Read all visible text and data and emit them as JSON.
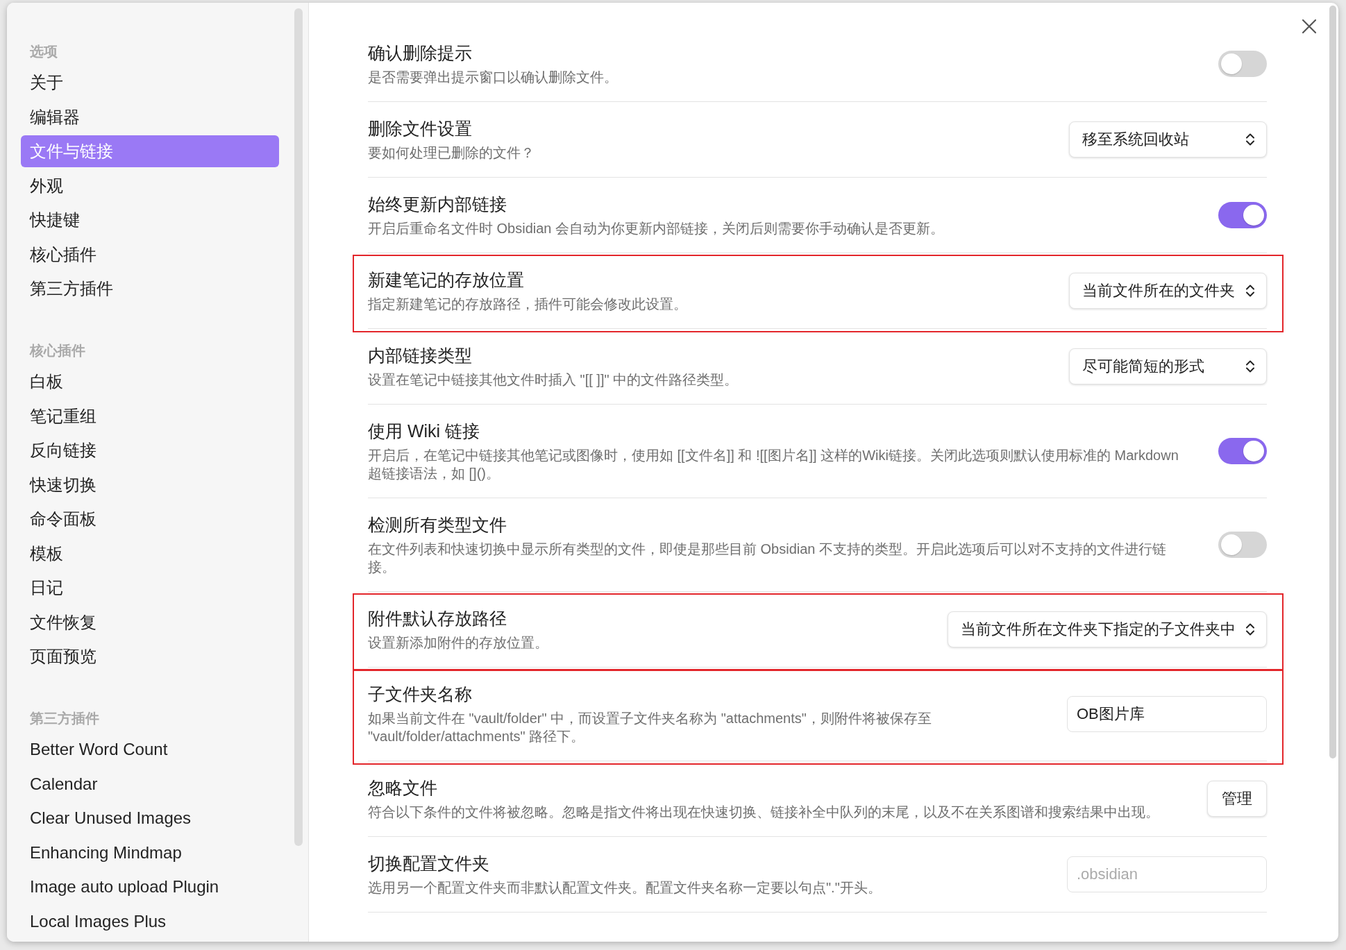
{
  "sidebar": {
    "groups": [
      {
        "heading": "选项",
        "items": [
          {
            "label": "关于",
            "selected": false
          },
          {
            "label": "编辑器",
            "selected": false
          },
          {
            "label": "文件与链接",
            "selected": true
          },
          {
            "label": "外观",
            "selected": false
          },
          {
            "label": "快捷键",
            "selected": false
          },
          {
            "label": "核心插件",
            "selected": false
          },
          {
            "label": "第三方插件",
            "selected": false
          }
        ]
      },
      {
        "heading": "核心插件",
        "items": [
          {
            "label": "白板",
            "selected": false
          },
          {
            "label": "笔记重组",
            "selected": false
          },
          {
            "label": "反向链接",
            "selected": false
          },
          {
            "label": "快速切换",
            "selected": false
          },
          {
            "label": "命令面板",
            "selected": false
          },
          {
            "label": "模板",
            "selected": false
          },
          {
            "label": "日记",
            "selected": false
          },
          {
            "label": "文件恢复",
            "selected": false
          },
          {
            "label": "页面预览",
            "selected": false
          }
        ]
      },
      {
        "heading": "第三方插件",
        "items": [
          {
            "label": "Better Word Count",
            "selected": false
          },
          {
            "label": "Calendar",
            "selected": false
          },
          {
            "label": "Clear Unused Images",
            "selected": false
          },
          {
            "label": "Enhancing Mindmap",
            "selected": false
          },
          {
            "label": "Image auto upload Plugin",
            "selected": false
          },
          {
            "label": "Local Images Plus",
            "selected": false
          }
        ]
      }
    ]
  },
  "settings": [
    {
      "title": "确认删除提示",
      "description": "是否需要弹出提示窗口以确认删除文件。",
      "highlighted": false,
      "control": {
        "kind": "toggle",
        "on": false
      }
    },
    {
      "title": "删除文件设置",
      "description": "要如何处理已删除的文件？",
      "highlighted": false,
      "control": {
        "kind": "dropdown",
        "value": "移至系统回收站"
      }
    },
    {
      "title": "始终更新内部链接",
      "description": "开启后重命名文件时 Obsidian 会自动为你更新内部链接，关闭后则需要你手动确认是否更新。",
      "highlighted": false,
      "control": {
        "kind": "toggle",
        "on": true
      }
    },
    {
      "title": "新建笔记的存放位置",
      "description": "指定新建笔记的存放路径，插件可能会修改此设置。",
      "highlighted": true,
      "control": {
        "kind": "dropdown",
        "value": "当前文件所在的文件夹"
      }
    },
    {
      "title": "内部链接类型",
      "description": "设置在笔记中链接其他文件时插入 \"[[ ]]\" 中的文件路径类型。",
      "highlighted": false,
      "control": {
        "kind": "dropdown",
        "value": "尽可能简短的形式"
      }
    },
    {
      "title": "使用 Wiki 链接",
      "description": "开启后，在笔记中链接其他笔记或图像时，使用如 [[文件名]] 和 ![[图片名]] 这样的Wiki链接。关闭此选项则默认使用标准的 Markdown 超链接语法，如 []()。",
      "highlighted": false,
      "control": {
        "kind": "toggle",
        "on": true
      }
    },
    {
      "title": "检测所有类型文件",
      "description": "在文件列表和快速切换中显示所有类型的文件，即使是那些目前 Obsidian 不支持的类型。开启此选项后可以对不支持的文件进行链接。",
      "highlighted": false,
      "control": {
        "kind": "toggle",
        "on": false
      }
    },
    {
      "title": "附件默认存放路径",
      "description": "设置新添加附件的存放位置。",
      "highlighted": true,
      "control": {
        "kind": "dropdown",
        "value": "当前文件所在文件夹下指定的子文件夹中"
      }
    },
    {
      "title": "子文件夹名称",
      "description": "如果当前文件在 \"vault/folder\" 中，而设置子文件夹名称为 \"attachments\"，则附件将被保存至 \"vault/folder/attachments\" 路径下。",
      "highlighted": true,
      "control": {
        "kind": "text",
        "value": "OB图片库"
      }
    },
    {
      "title": "忽略文件",
      "description": "符合以下条件的文件将被忽略。忽略是指文件将出现在快速切换、链接补全中队列的末尾，以及不在关系图谱和搜索结果中出现。",
      "highlighted": false,
      "control": {
        "kind": "button",
        "label": "管理"
      }
    },
    {
      "title": "切换配置文件夹",
      "description": "选用另一个配置文件夹而非默认配置文件夹。配置文件夹名称一定要以句点\".\"开头。",
      "highlighted": false,
      "control": {
        "kind": "text",
        "placeholder": ".obsidian"
      }
    }
  ]
}
